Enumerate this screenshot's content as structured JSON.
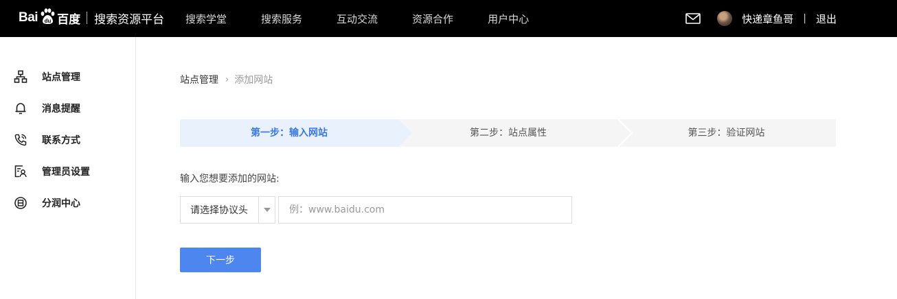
{
  "brand": {
    "logo_text_left": "Bai",
    "logo_text_right": "百度",
    "subtitle": "搜索资源平台"
  },
  "topnav": {
    "items": [
      "搜索学堂",
      "搜索服务",
      "互动交流",
      "资源合作",
      "用户中心"
    ]
  },
  "user": {
    "name": "快递章鱼哥",
    "divider": "|",
    "logout": "退出"
  },
  "sidebar": {
    "items": [
      {
        "label": "站点管理",
        "icon": "sitemap-icon"
      },
      {
        "label": "消息提醒",
        "icon": "bell-icon"
      },
      {
        "label": "联系方式",
        "icon": "phone-icon"
      },
      {
        "label": "管理员设置",
        "icon": "admin-icon"
      },
      {
        "label": "分润中心",
        "icon": "revenue-icon"
      }
    ]
  },
  "breadcrumb": {
    "parent": "站点管理",
    "separator": "›",
    "current": "添加网站"
  },
  "steps": [
    {
      "label": "第一步：输入网站",
      "active": true
    },
    {
      "label": "第二步：站点属性",
      "active": false
    },
    {
      "label": "第三步：验证网站",
      "active": false
    }
  ],
  "form": {
    "label": "输入您想要添加的网站:",
    "protocol_select": "请选择协议头",
    "url_placeholder": "例：www.baidu.com",
    "url_value": ""
  },
  "next_button": "下一步",
  "colors": {
    "topbar_bg": "#000000",
    "accent": "#4e86ef",
    "active_step_bg": "#e9f1fd",
    "active_step_text": "#3a78e6",
    "inactive_step_bg": "#f5f5f5"
  }
}
